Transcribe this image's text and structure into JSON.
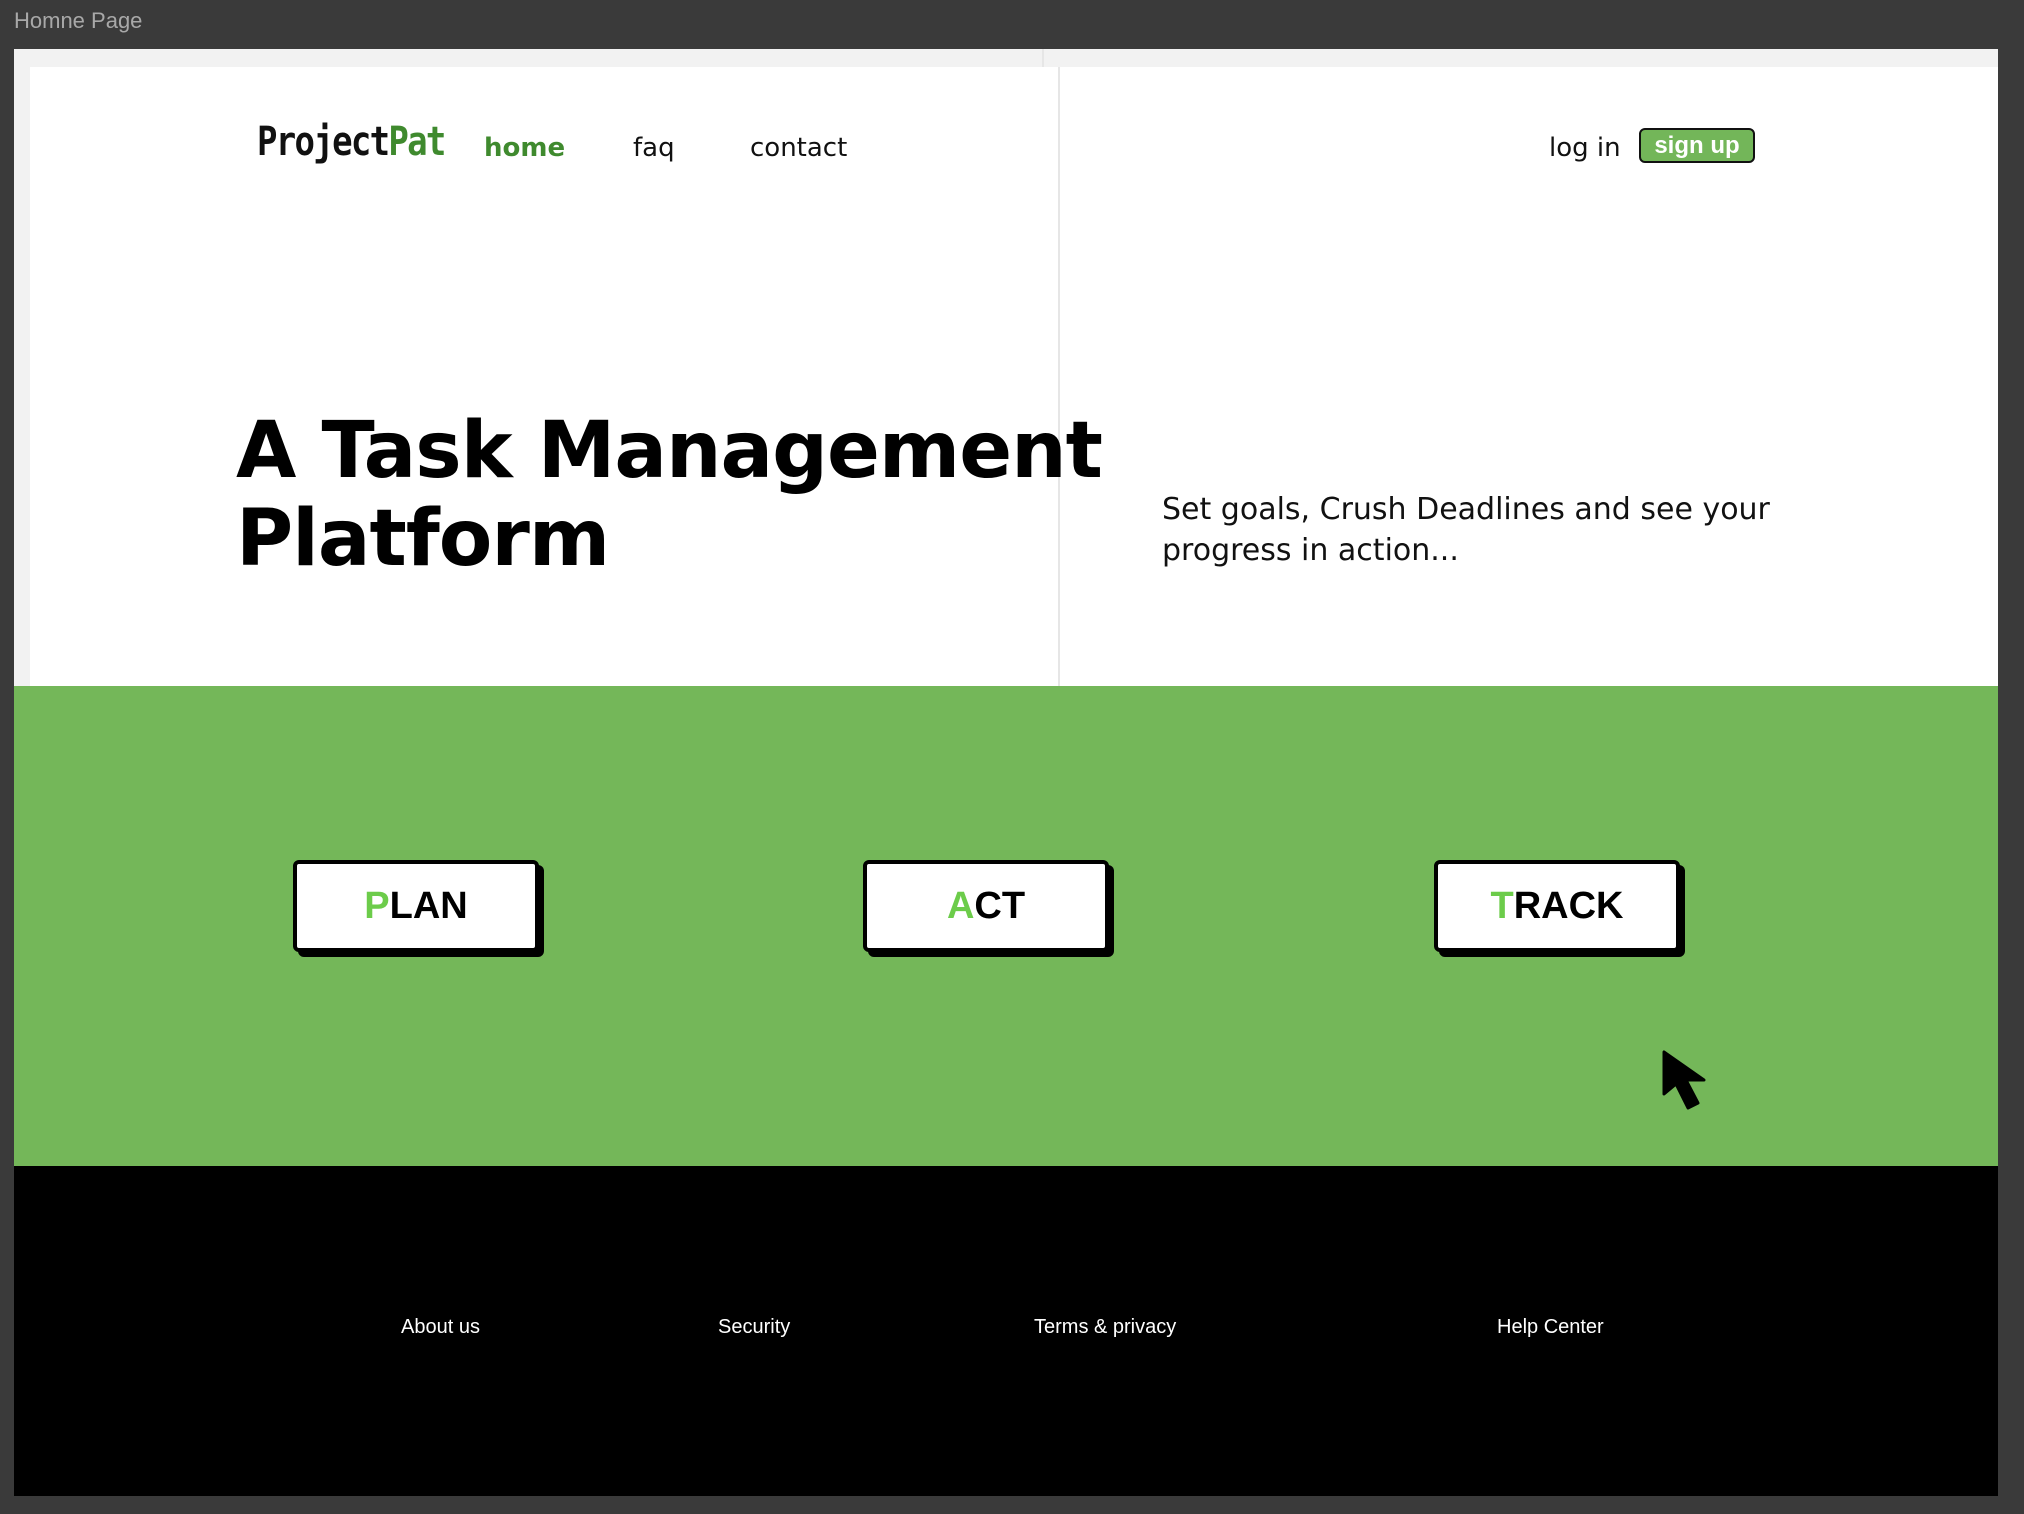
{
  "window": {
    "title": "Homne Page"
  },
  "header": {
    "logo": {
      "part1": "Project",
      "part2": "Pat"
    },
    "nav": [
      {
        "label": "home",
        "active": true
      },
      {
        "label": "faq",
        "active": false
      },
      {
        "label": "contact",
        "active": false
      }
    ],
    "login_label": "log in",
    "signup_label": "sign up"
  },
  "hero": {
    "headline_line1": "A Task Management",
    "headline_line2": "Platform",
    "tagline": "Set goals, Crush Deadlines and see your progress in action..."
  },
  "steps": [
    {
      "first_letter": "P",
      "rest": "LAN"
    },
    {
      "first_letter": "A",
      "rest": "CT"
    },
    {
      "first_letter": "T",
      "rest": "RACK"
    }
  ],
  "footer": {
    "links": [
      "About us",
      "Security",
      "Terms & privacy",
      "Help Center"
    ]
  },
  "colors": {
    "brand_green": "#74b759",
    "accent_green_text": "#3f8a2e",
    "step_letter_green": "#6ccc4a",
    "footer_bg": "#000000"
  }
}
